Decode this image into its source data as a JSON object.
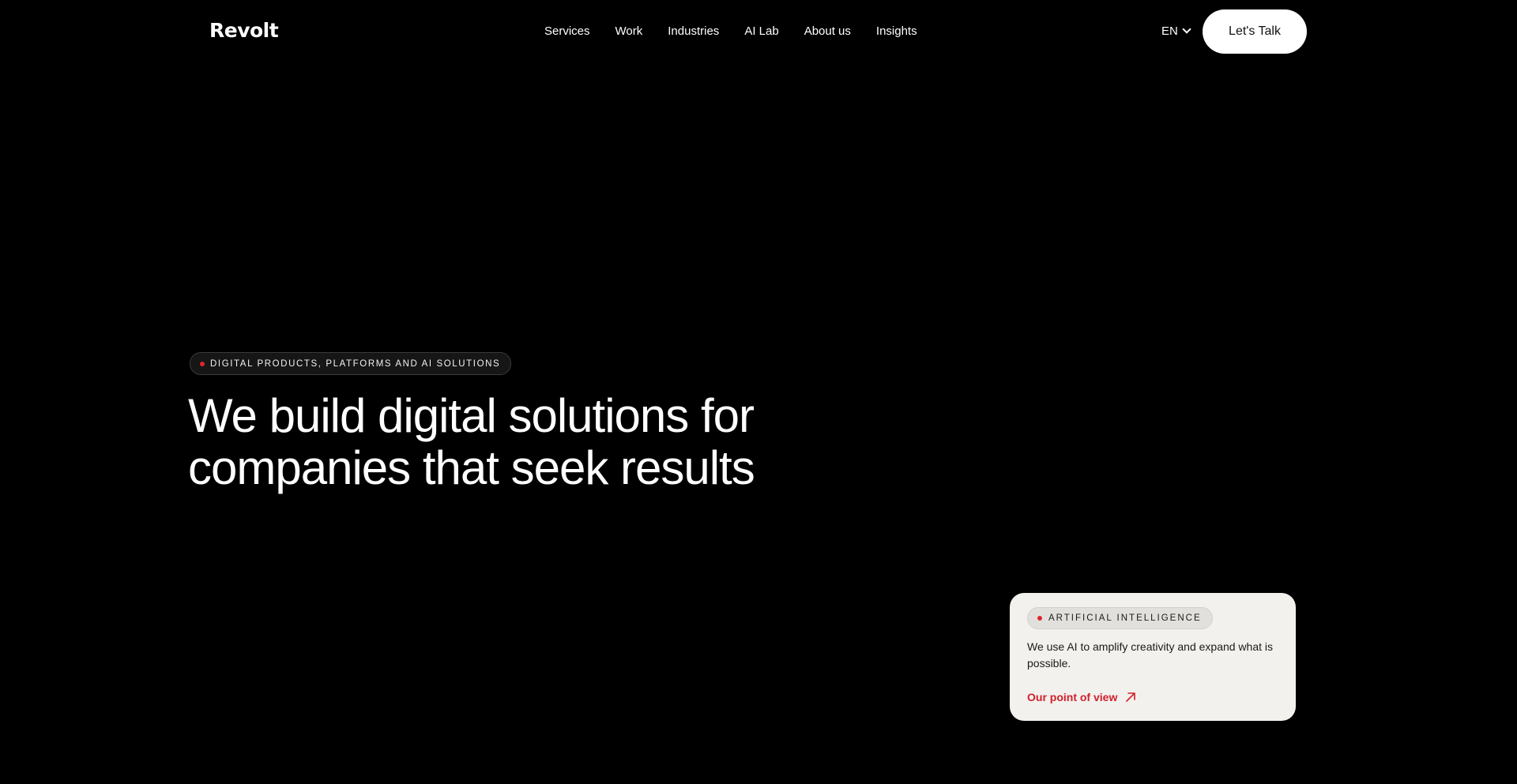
{
  "header": {
    "logo": "Revolt",
    "nav": [
      "Services",
      "Work",
      "Industries",
      "AI Lab",
      "About us",
      "Insights"
    ],
    "language": "EN",
    "cta_label": "Let's Talk"
  },
  "hero": {
    "eyebrow": "DIGITAL PRODUCTS, PLATFORMS AND AI SOLUTIONS",
    "headline_line1": "We build digital solutions for",
    "headline_line2": "companies that seek results"
  },
  "card": {
    "badge": "ARTIFICIAL INTELLIGENCE",
    "description": "We use AI to amplify creativity and expand what is possible.",
    "link_label": "Our point of view"
  },
  "colors": {
    "background": "#000000",
    "accent": "#d21f2a",
    "card_background": "#f2f1ee",
    "text_primary": "#ffffff"
  },
  "icons": {
    "language_dropdown": "chevron-down-icon",
    "status_dot": "red-dot-icon",
    "link_arrow": "arrow-up-right-icon"
  }
}
